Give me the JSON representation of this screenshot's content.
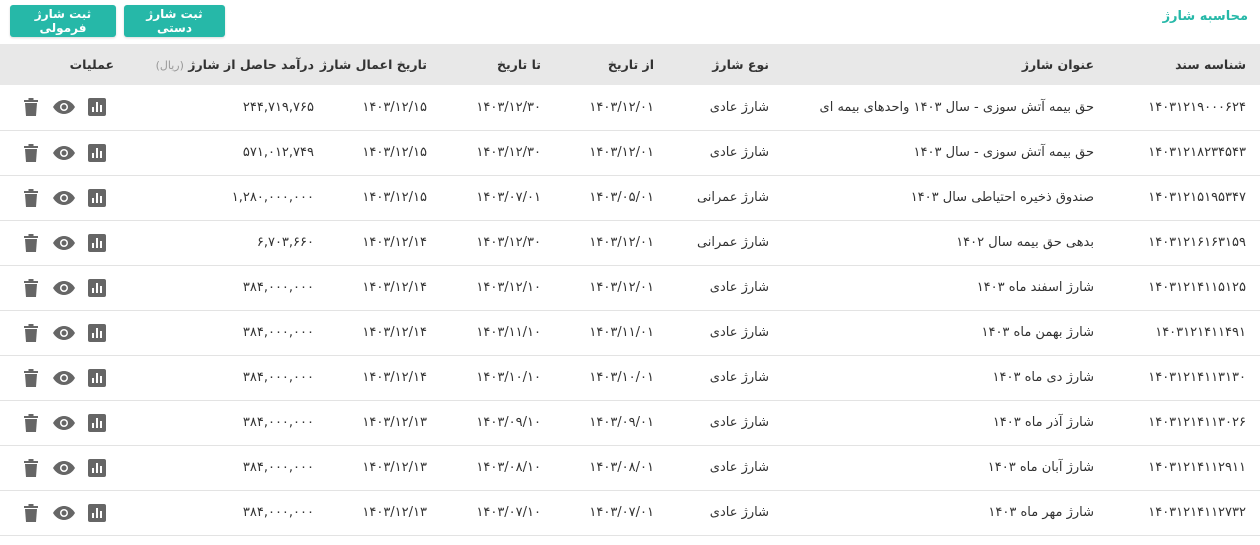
{
  "header": {
    "title": "محاسبه شارژ",
    "manual_button": "ثبت شارژ دستی",
    "formula_button": "ثبت شارژ فرمولی"
  },
  "table": {
    "columns": {
      "doc_id": "شناسه سند",
      "title": "عنوان شارژ",
      "type": "نوع شارژ",
      "from": "از تاریخ",
      "to": "تا تاریخ",
      "apply_date": "تاریخ اعمال شارژ",
      "income": "درآمد حاصل از شارژ",
      "income_unit": "(ریال)",
      "operations": "عملیات"
    },
    "rows": [
      {
        "doc_id": "۱۴۰۳۱۲۱۹۰۰۰۶۲۴",
        "title": "حق بیمه آتش سوزی - سال ۱۴۰۳ واحدهای بیمه ای",
        "type": "شارژ عادی",
        "from": "۱۴۰۳/۱۲/۰۱",
        "to": "۱۴۰۳/۱۲/۳۰",
        "apply_date": "۱۴۰۳/۱۲/۱۵",
        "income": "۲۴۴,۷۱۹,۷۶۵"
      },
      {
        "doc_id": "۱۴۰۳۱۲۱۸۲۳۴۵۴۳",
        "title": "حق بیمه آتش سوزی - سال ۱۴۰۳",
        "type": "شارژ عادی",
        "from": "۱۴۰۳/۱۲/۰۱",
        "to": "۱۴۰۳/۱۲/۳۰",
        "apply_date": "۱۴۰۳/۱۲/۱۵",
        "income": "۵۷۱,۰۱۲,۷۴۹"
      },
      {
        "doc_id": "۱۴۰۳۱۲۱۵۱۹۵۳۴۷",
        "title": "صندوق ذخیره احتیاطی سال ۱۴۰۳",
        "type": "شارژ عمرانی",
        "from": "۱۴۰۳/۰۵/۰۱",
        "to": "۱۴۰۳/۰۷/۰۱",
        "apply_date": "۱۴۰۳/۱۲/۱۵",
        "income": "۱,۲۸۰,۰۰۰,۰۰۰"
      },
      {
        "doc_id": "۱۴۰۳۱۲۱۶۱۶۳۱۵۹",
        "title": "بدهی حق بیمه سال ۱۴۰۲",
        "type": "شارژ عمرانی",
        "from": "۱۴۰۳/۱۲/۰۱",
        "to": "۱۴۰۳/۱۲/۳۰",
        "apply_date": "۱۴۰۳/۱۲/۱۴",
        "income": "۶,۷۰۳,۶۶۰"
      },
      {
        "doc_id": "۱۴۰۳۱۲۱۴۱۱۵۱۲۵",
        "title": "شارژ اسفند ماه ۱۴۰۳",
        "type": "شارژ عادی",
        "from": "۱۴۰۳/۱۲/۰۱",
        "to": "۱۴۰۳/۱۲/۱۰",
        "apply_date": "۱۴۰۳/۱۲/۱۴",
        "income": "۳۸۴,۰۰۰,۰۰۰"
      },
      {
        "doc_id": "۱۴۰۳۱۲۱۴۱۱۴۹۱",
        "title": "شارژ بهمن ماه ۱۴۰۳",
        "type": "شارژ عادی",
        "from": "۱۴۰۳/۱۱/۰۱",
        "to": "۱۴۰۳/۱۱/۱۰",
        "apply_date": "۱۴۰۳/۱۲/۱۴",
        "income": "۳۸۴,۰۰۰,۰۰۰"
      },
      {
        "doc_id": "۱۴۰۳۱۲۱۴۱۱۳۱۳۰",
        "title": "شارژ دی ماه ۱۴۰۳",
        "type": "شارژ عادی",
        "from": "۱۴۰۳/۱۰/۰۱",
        "to": "۱۴۰۳/۱۰/۱۰",
        "apply_date": "۱۴۰۳/۱۲/۱۴",
        "income": "۳۸۴,۰۰۰,۰۰۰"
      },
      {
        "doc_id": "۱۴۰۳۱۲۱۴۱۱۳۰۲۶",
        "title": "شارژ آذر ماه ۱۴۰۳",
        "type": "شارژ عادی",
        "from": "۱۴۰۳/۰۹/۰۱",
        "to": "۱۴۰۳/۰۹/۱۰",
        "apply_date": "۱۴۰۳/۱۲/۱۳",
        "income": "۳۸۴,۰۰۰,۰۰۰"
      },
      {
        "doc_id": "۱۴۰۳۱۲۱۴۱۱۲۹۱۱",
        "title": "شارژ آبان ماه ۱۴۰۳",
        "type": "شارژ عادی",
        "from": "۱۴۰۳/۰۸/۰۱",
        "to": "۱۴۰۳/۰۸/۱۰",
        "apply_date": "۱۴۰۳/۱۲/۱۳",
        "income": "۳۸۴,۰۰۰,۰۰۰"
      },
      {
        "doc_id": "۱۴۰۳۱۲۱۴۱۱۲۷۳۲",
        "title": "شارژ مهر ماه ۱۴۰۳",
        "type": "شارژ عادی",
        "from": "۱۴۰۳/۰۷/۰۱",
        "to": "۱۴۰۳/۰۷/۱۰",
        "apply_date": "۱۴۰۳/۱۲/۱۳",
        "income": "۳۸۴,۰۰۰,۰۰۰"
      }
    ],
    "row_actions": [
      "chart-icon",
      "eye-icon",
      "trash-icon"
    ]
  },
  "colors": {
    "accent": "#26b8a8",
    "header_bg": "#e8e8e8",
    "icon": "#666666"
  }
}
